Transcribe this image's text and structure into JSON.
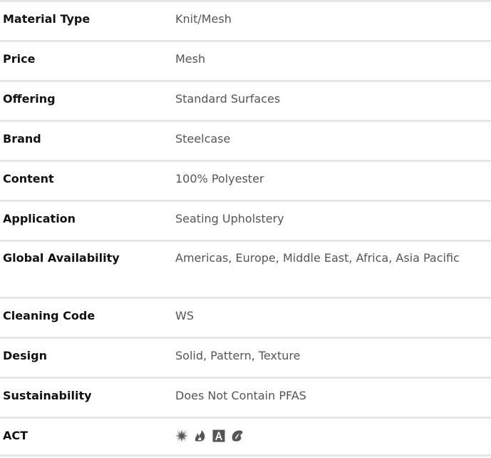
{
  "specs": [
    {
      "label": "Material Type",
      "value": "Knit/Mesh"
    },
    {
      "label": "Price",
      "value": "Mesh"
    },
    {
      "label": "Offering",
      "value": "Standard Surfaces"
    },
    {
      "label": "Brand",
      "value": "Steelcase"
    },
    {
      "label": "Content",
      "value": "100% Polyester"
    },
    {
      "label": "Application",
      "value": "Seating Upholstery"
    },
    {
      "label": "Global Availability",
      "value": "Americas, Europe, Middle East, Africa, Asia Pacific"
    },
    {
      "label": "Cleaning Code",
      "value": "WS"
    },
    {
      "label": "Design",
      "value": "Solid, Pattern, Texture"
    },
    {
      "label": "Sustainability",
      "value": "Does Not Contain PFAS"
    },
    {
      "label": "ACT",
      "icons": [
        "sunburst-icon",
        "flame-icon",
        "letter-a-icon",
        "palette-icon"
      ]
    }
  ],
  "colors": {
    "divider": "#e6e6e6",
    "label": "#111111",
    "value": "#555555",
    "icon": "#555555"
  }
}
